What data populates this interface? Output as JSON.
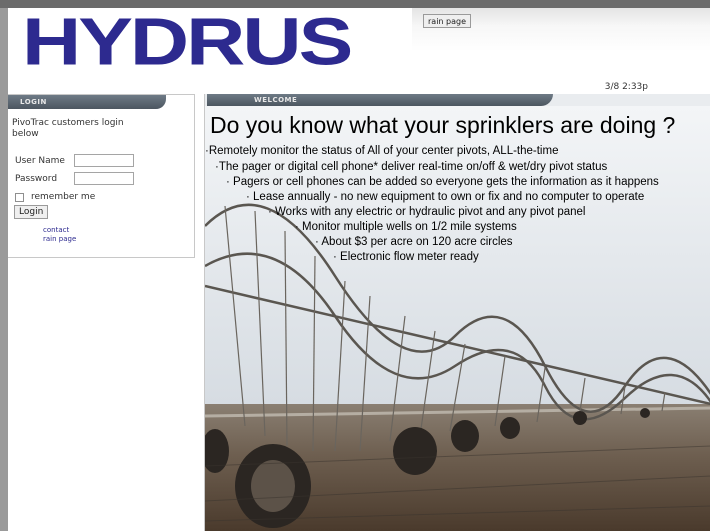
{
  "header": {
    "logo_text": "HYDRUS",
    "rain_button_label": "rain page",
    "timestamp": "3/8 2:33p"
  },
  "login": {
    "tab_label": "LOGIN",
    "intro": "PivoTrac customers login below",
    "username_label": "User Name",
    "username_value": "",
    "password_label": "Password",
    "password_value": "",
    "remember_label": "remember me",
    "login_button_label": "Login",
    "links": {
      "contact": "contact",
      "rain_page": "rain page"
    }
  },
  "welcome": {
    "tab_label": "WELCOME",
    "title": "Do you know what your sprinklers are doing ?",
    "bullets": [
      "·Remotely monitor the status of All of your center pivots,  ALL-the-time",
      "·The pager or digital cell phone* deliver real-time on/off & wet/dry pivot status",
      "·  Pagers or cell phones can be added so everyone gets the information as it happens",
      "·  Lease annually - no new equipment to own or fix and no computer to operate",
      "·  Works with any electric or hydraulic pivot and any pivot panel",
      "·  Monitor multiple wells on 1/2 mile systems",
      "·  About $3 per acre on 120 acre circles",
      "·   Electronic flow meter ready"
    ]
  },
  "colors": {
    "logo": "#2d2a8f",
    "tab": "#4c5660",
    "link": "#2d2a8f"
  }
}
